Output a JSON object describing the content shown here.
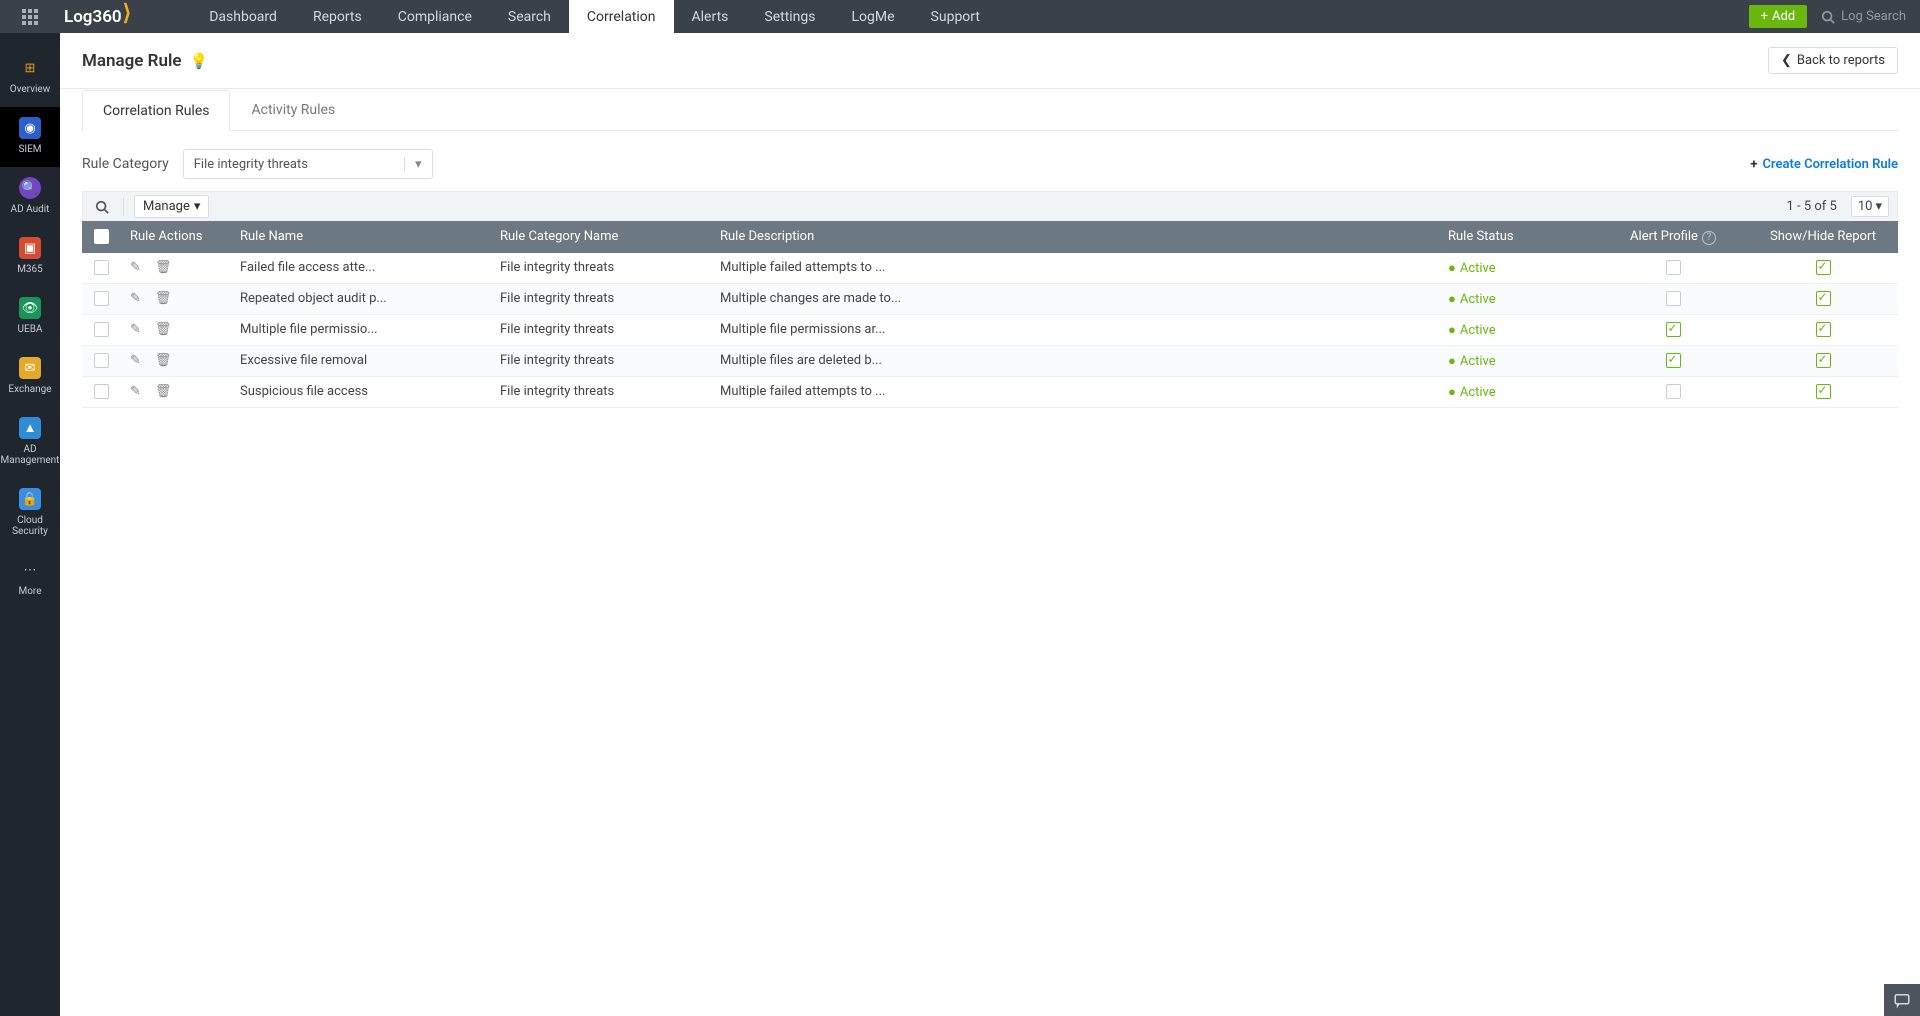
{
  "app": {
    "name": "Log360"
  },
  "topnav": {
    "items": [
      {
        "label": "Dashboard"
      },
      {
        "label": "Reports"
      },
      {
        "label": "Compliance"
      },
      {
        "label": "Search"
      },
      {
        "label": "Correlation",
        "active": true
      },
      {
        "label": "Alerts"
      },
      {
        "label": "Settings"
      },
      {
        "label": "LogMe"
      },
      {
        "label": "Support"
      }
    ],
    "add_label": "Add",
    "search_placeholder": "Log Search"
  },
  "sidebar": {
    "items": [
      {
        "label": "Overview"
      },
      {
        "label": "SIEM",
        "active": true
      },
      {
        "label": "AD Audit"
      },
      {
        "label": "M365"
      },
      {
        "label": "UEBA"
      },
      {
        "label": "Exchange"
      },
      {
        "label": "AD Management"
      },
      {
        "label": "Cloud Security"
      },
      {
        "label": "More"
      }
    ]
  },
  "page": {
    "title": "Manage Rule",
    "back_label": "Back to reports"
  },
  "tabs": {
    "items": [
      {
        "label": "Correlation Rules",
        "active": true
      },
      {
        "label": "Activity Rules"
      }
    ]
  },
  "controls": {
    "category_label": "Rule Category",
    "category_value": "File integrity threats",
    "create_label": "Create Correlation Rule"
  },
  "toolbar": {
    "manage_label": "Manage",
    "range_text": "1 - 5 of 5",
    "page_size": "10"
  },
  "table": {
    "headers": {
      "actions": "Rule Actions",
      "name": "Rule Name",
      "category": "Rule Category Name",
      "description": "Rule Description",
      "status": "Rule Status",
      "alert": "Alert Profile",
      "showhide": "Show/Hide Report"
    },
    "rows": [
      {
        "name": "Failed file access atte...",
        "category": "File integrity threats",
        "description": "Multiple failed attempts to ...",
        "status": "Active",
        "alert": false,
        "showhide": true
      },
      {
        "name": "Repeated object audit p...",
        "category": "File integrity threats",
        "description": "Multiple changes are made to...",
        "status": "Active",
        "alert": false,
        "showhide": true
      },
      {
        "name": "Multiple file permissio...",
        "category": "File integrity threats",
        "description": "Multiple file permissions ar...",
        "status": "Active",
        "alert": true,
        "showhide": true
      },
      {
        "name": "Excessive file removal",
        "category": "File integrity threats",
        "description": "Multiple files are deleted b...",
        "status": "Active",
        "alert": true,
        "showhide": true
      },
      {
        "name": "Suspicious file access",
        "category": "File integrity threats",
        "description": "Multiple failed attempts to ...",
        "status": "Active",
        "alert": false,
        "showhide": true
      }
    ]
  }
}
